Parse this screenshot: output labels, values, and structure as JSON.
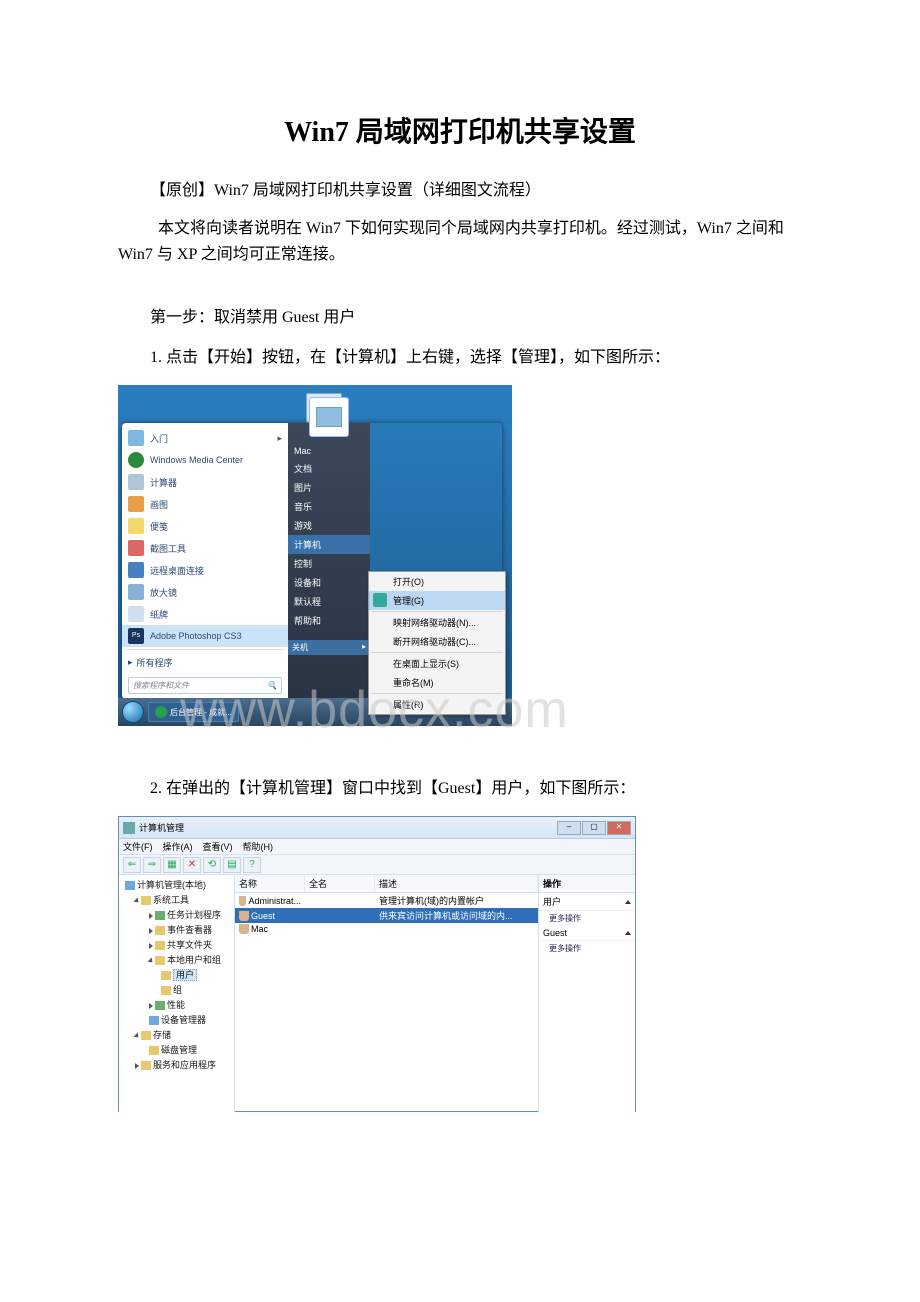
{
  "title": "Win7 局域网打印机共享设置",
  "subtitle": "【原创】Win7 局域网打印机共享设置（详细图文流程）",
  "intro": "本文将向读者说明在 Win7 下如何实现同个局域网内共享打印机。经过测试，Win7 之间和 Win7 与 XP 之间均可正常连接。",
  "step1_title": "第一步：取消禁用 Guest 用户",
  "step1_body": "1. 点击【开始】按钮，在【计算机】上右键，选择【管理】，如下图所示：",
  "step2_body": "2. 在弹出的【计算机管理】窗口中找到【Guest】用户，如下图所示：",
  "watermark": "www.bdocx.com",
  "shot1": {
    "left_items": [
      {
        "label": "入门",
        "arrow": true
      },
      {
        "label": "Windows Media Center"
      },
      {
        "label": "计算器"
      },
      {
        "label": "画图"
      },
      {
        "label": "便笺"
      },
      {
        "label": "截图工具"
      },
      {
        "label": "远程桌面连接"
      },
      {
        "label": "放大镜"
      },
      {
        "label": "纸牌"
      },
      {
        "label": "Adobe Photoshop CS3"
      }
    ],
    "all_programs": "所有程序",
    "search_placeholder": "搜索程序和文件",
    "right_items": [
      "Mac",
      "文档",
      "图片",
      "音乐",
      "游戏",
      "计算机",
      "控制",
      "设备和",
      "默认程",
      "帮助和"
    ],
    "right_highlight_index": 5,
    "shutdown": "关机",
    "context_menu": [
      "打开(O)",
      "管理(G)",
      "映射网络驱动器(N)...",
      "断开网络驱动器(C)...",
      "在桌面上显示(S)",
      "重命名(M)",
      "属性(R)"
    ],
    "context_highlight_index": 1,
    "task_label": "后台管理 - 成就..."
  },
  "shot2": {
    "window_title": "计算机管理",
    "menus": [
      "文件(F)",
      "操作(A)",
      "查看(V)",
      "帮助(H)"
    ],
    "tree": {
      "root": "计算机管理(本地)",
      "sys_tools": "系统工具",
      "task": "任务计划程序",
      "event": "事件查看器",
      "shared": "共享文件夹",
      "local_usr": "本地用户和组",
      "users": "用户",
      "groups": "组",
      "perf": "性能",
      "devmgr": "设备管理器",
      "storage": "存储",
      "disk": "磁盘管理",
      "services": "服务和应用程序"
    },
    "columns": [
      "名称",
      "全名",
      "描述"
    ],
    "rows": [
      {
        "name": "Administrat...",
        "full": "",
        "desc": "管理计算机(域)的内置帐户"
      },
      {
        "name": "Guest",
        "full": "",
        "desc": "供来宾访问计算机或访问域的内..."
      },
      {
        "name": "Mac",
        "full": "",
        "desc": ""
      }
    ],
    "highlight_row_index": 1,
    "actions": {
      "header": "操作",
      "sec1": "用户",
      "sec1_more": "更多操作",
      "sec2": "Guest",
      "sec2_more": "更多操作"
    }
  }
}
